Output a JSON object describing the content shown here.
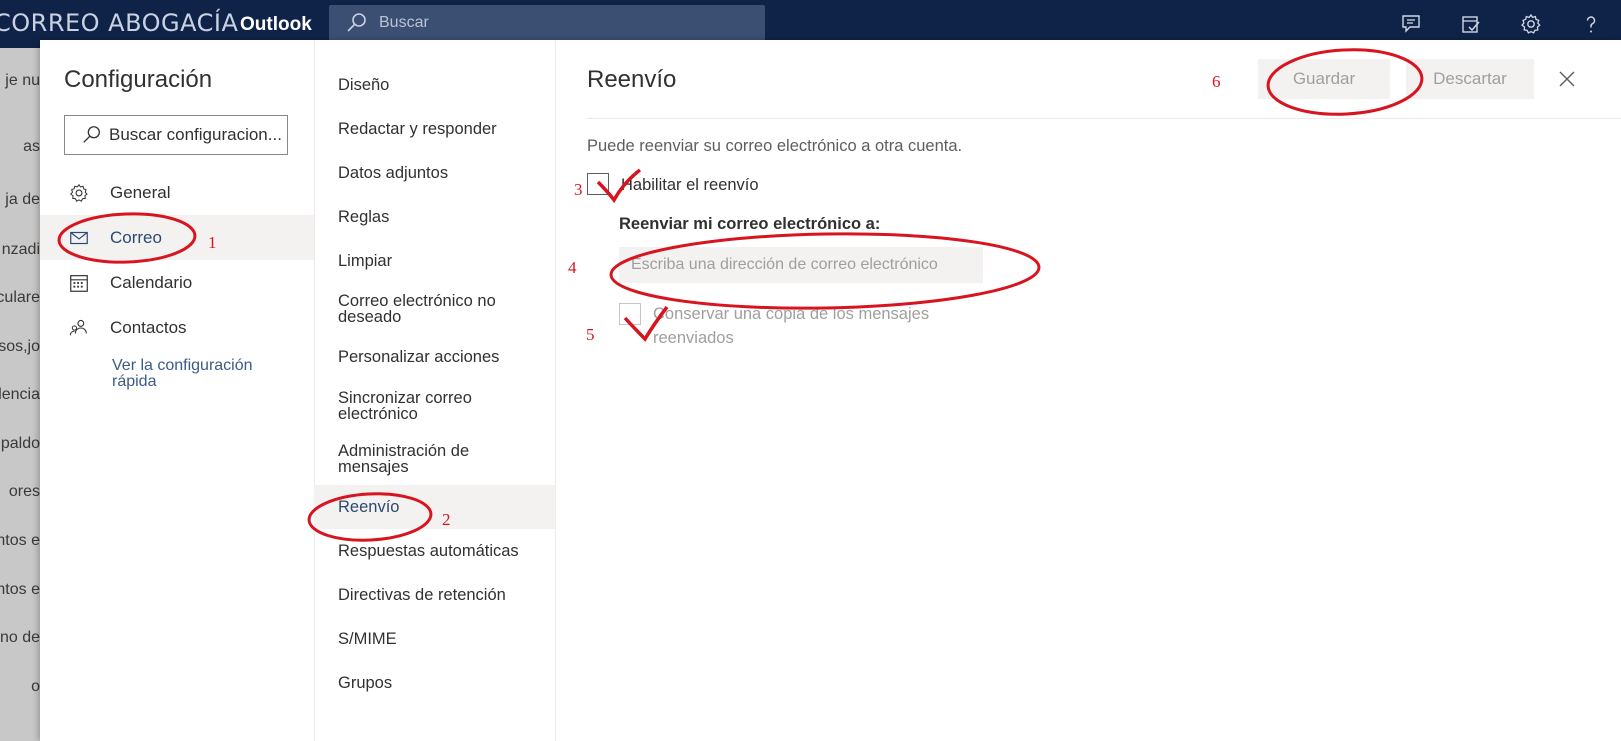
{
  "topbar": {
    "brand": "CORREO ABOGACÍA",
    "app_name": "Outlook",
    "search_placeholder": "Buscar",
    "icons": [
      "feedback-icon",
      "tasks-icon",
      "gear-icon",
      "help-icon"
    ],
    "color": "#0f2349"
  },
  "background_sliver": {
    "items": [
      "je nu",
      "as",
      "ja de",
      "nzadi",
      "culare",
      "sos,jo",
      "dencia",
      "paldo",
      "ores",
      "ntos e",
      "ntos e",
      "no de",
      "o"
    ]
  },
  "settings": {
    "title": "Configuración",
    "search_placeholder": "Buscar configuracion...",
    "nav": [
      {
        "label": "General",
        "icon": "gear-icon"
      },
      {
        "label": "Correo",
        "icon": "mail-icon",
        "active": true
      },
      {
        "label": "Calendario",
        "icon": "calendar-icon"
      },
      {
        "label": "Contactos",
        "icon": "people-icon"
      }
    ],
    "quick_link": "Ver la configuración rápida"
  },
  "mail_nav": {
    "items": [
      {
        "label": "Diseño"
      },
      {
        "label": "Redactar y responder"
      },
      {
        "label": "Datos adjuntos"
      },
      {
        "label": "Reglas"
      },
      {
        "label": "Limpiar"
      },
      {
        "label": "Correo electrónico no deseado"
      },
      {
        "label": "Personalizar acciones"
      },
      {
        "label": "Sincronizar correo electrónico"
      },
      {
        "label": "Administración de mensajes"
      },
      {
        "label": "Reenvío",
        "active": true
      },
      {
        "label": "Respuestas automáticas"
      },
      {
        "label": "Directivas de retención"
      },
      {
        "label": "S/MIME"
      },
      {
        "label": "Grupos"
      }
    ]
  },
  "forwarding": {
    "title": "Reenvío",
    "save_label": "Guardar",
    "discard_label": "Descartar",
    "description": "Puede reenviar su correo electrónico a otra cuenta.",
    "enable_label": "Habilitar el reenvío",
    "enable_checked": true,
    "forward_to_label": "Reenviar mi correo electrónico a:",
    "email_placeholder": "Escriba una dirección de correo electrónico",
    "keep_copy_label": "Conservar una copia de los mensajes reenviados",
    "keep_copy_checked": true
  },
  "annotations": {
    "color": "#d8141f",
    "steps": [
      "1",
      "2",
      "3",
      "4",
      "5",
      "6"
    ]
  }
}
